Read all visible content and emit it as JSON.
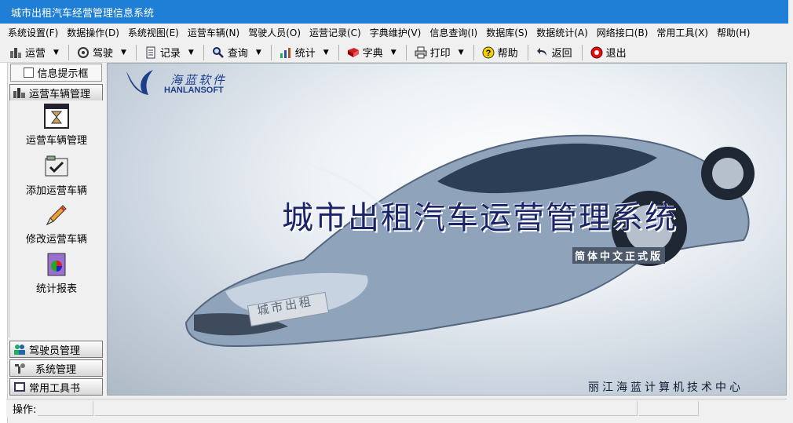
{
  "window": {
    "title": "城市出租汽车经营管理信息系统"
  },
  "menu": [
    "系统设置(F)",
    "数据操作(D)",
    "系统视图(E)",
    "运营车辆(N)",
    "驾驶人员(O)",
    "运营记录(C)",
    "字典维护(V)",
    "信息查询(I)",
    "数据库(S)",
    "数据统计(A)",
    "网络接口(B)",
    "常用工具(X)",
    "帮助(H)"
  ],
  "toolbar": {
    "yunying": "运营",
    "jiashi": "驾驶",
    "jilu": "记录",
    "chaxun": "查询",
    "tongji": "统计",
    "zidian": "字典",
    "dayin": "打印",
    "bangzhu": "帮助",
    "fanhui": "返回",
    "tuichu": "退出"
  },
  "left": {
    "info_checkbox": "信息提示框",
    "group_vehicles": "运营车辆管理",
    "items": [
      "运营车辆管理",
      "添加运营车辆",
      "修改运营车辆",
      "统计报表"
    ],
    "group_drivers": "驾驶员管理",
    "group_system": "系统管理",
    "group_tools": "常用工具书"
  },
  "banner": {
    "logo_cn": "海蓝软件",
    "logo_en": "HANLANSOFT",
    "title": "城市出租汽车运营管理系统",
    "edition": "简体中文正式版",
    "plate": "城市出租",
    "footer": "丽江海蓝计算机技术中心"
  },
  "status": {
    "label": "操作:"
  }
}
